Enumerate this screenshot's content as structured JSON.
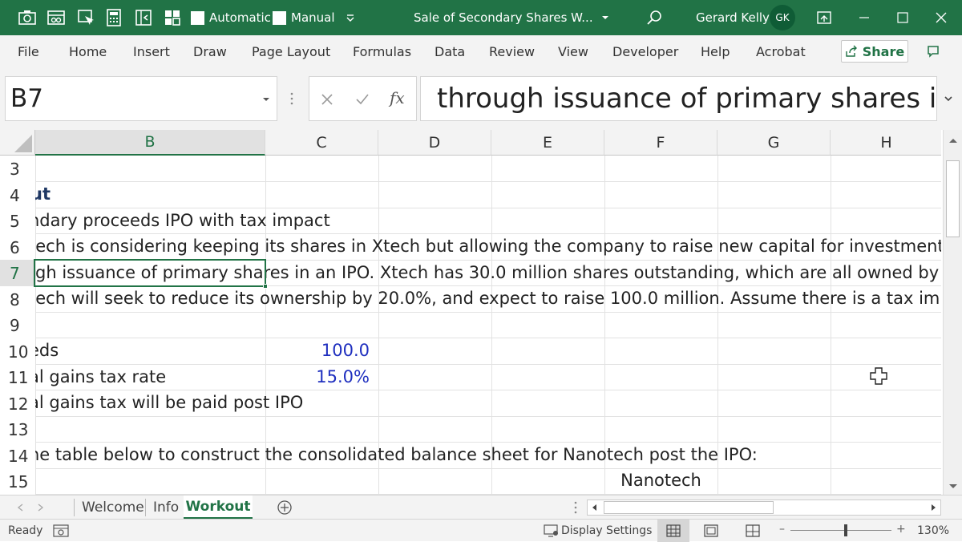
{
  "titlebar": {
    "autosave_label": "Automatic",
    "manual_label": "Manual",
    "doc_title": "Sale of Secondary Shares W...",
    "user_name": "Gerard Kelly",
    "user_initials": "GK"
  },
  "ribbon": {
    "tabs": [
      "File",
      "Home",
      "Insert",
      "Draw",
      "Page Layout",
      "Formulas",
      "Data",
      "Review",
      "View",
      "Developer",
      "Help",
      "Acrobat"
    ],
    "share_label": "Share"
  },
  "formula_bar": {
    "name_box": "B7",
    "fx_label": "fx",
    "content": "through issuance of primary shares in"
  },
  "grid": {
    "columns": [
      "B",
      "C",
      "D",
      "E",
      "F",
      "G",
      "H"
    ],
    "rows": [
      "3",
      "4",
      "5",
      "6",
      "7",
      "8",
      "9",
      "10",
      "11",
      "12",
      "13",
      "14",
      "15"
    ],
    "cells": {
      "r4": "ut",
      "r5": "ndary proceeds IPO with tax impact",
      "r6": "tech is considering keeping its shares in Xtech but allowing the company to raise new capital for investments",
      "r7": "gh issuance of primary shares in an IPO. Xtech has 30.0 million shares outstanding, which are all owned by Nanotech",
      "r8": "tech will seek to reduce its ownership by 20.0%, and expect to raise 100.0 million. Assume there is a tax impact.",
      "r10_b": "eds",
      "r10_c": "100.0",
      "r11_b": "al gains tax rate",
      "r11_c": "15.0%",
      "r12": "al gains tax will be paid post IPO",
      "r14": "he table below to construct the consolidated balance sheet for Nanotech post the IPO:",
      "r15_f": "Nanotech"
    }
  },
  "sheets": {
    "tabs": [
      "Welcome",
      "Info",
      "Workout"
    ],
    "active": "Workout"
  },
  "statusbar": {
    "ready": "Ready",
    "display_settings": "Display Settings",
    "zoom": "130%"
  },
  "colors": {
    "accent": "#217346",
    "input_blue": "#1f2fbf"
  }
}
